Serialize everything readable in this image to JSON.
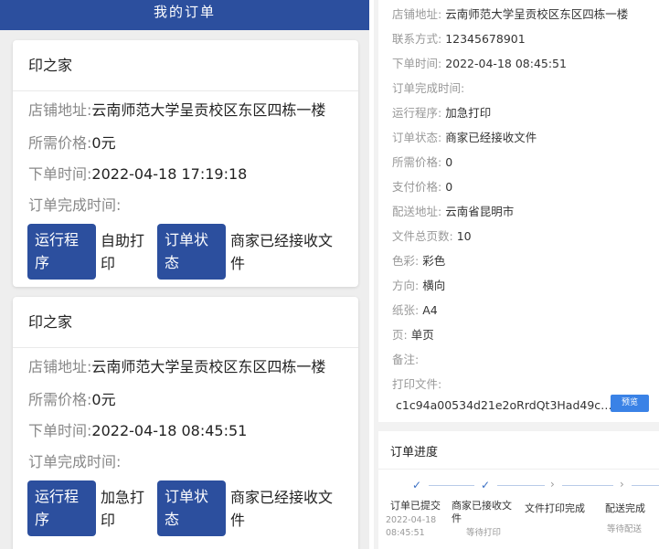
{
  "left": {
    "header_title": "我的订单",
    "orders": [
      {
        "shop_name": "印之家",
        "address_label": "店铺地址:",
        "address": "云南师范大学呈贡校区东区四栋一楼",
        "price_label": "所需价格:",
        "price": "0元",
        "order_time_label": "下单时间:",
        "order_time": "2022-04-18 17:19:18",
        "complete_time_label": "订单完成时间:",
        "program_chip_line1": "运行程",
        "program_chip_line2": "序",
        "program_value_line1": "自助打",
        "program_value_line2": "印",
        "status_chip_line1": "订单状",
        "status_chip_line2": "态",
        "status_value_line1": "商家已经接收文",
        "status_value_line2": "件"
      },
      {
        "shop_name": "印之家",
        "address_label": "店铺地址:",
        "address": "云南师范大学呈贡校区东区四栋一楼",
        "price_label": "所需价格:",
        "price": "0元",
        "order_time_label": "下单时间:",
        "order_time": "2022-04-18 08:45:51",
        "complete_time_label": "订单完成时间:",
        "program_chip_line1": "运行程",
        "program_chip_line2": "序",
        "program_value_line1": "加急打",
        "program_value_line2": "印",
        "status_chip_line1": "订单状",
        "status_chip_line2": "态",
        "status_value_line1": "商家已经接收文",
        "status_value_line2": "件"
      }
    ]
  },
  "right": {
    "details": [
      {
        "label": "店铺地址:",
        "value": "云南师范大学呈贡校区东区四栋一楼"
      },
      {
        "label": "联系方式:",
        "value": "12345678901"
      },
      {
        "label": "下单时间:",
        "value": "2022-04-18 08:45:51"
      },
      {
        "label": "订单完成时间:",
        "value": ""
      },
      {
        "label": "运行程序:",
        "value": "加急打印"
      },
      {
        "label": "订单状态:",
        "value": "商家已经接收文件"
      },
      {
        "label": "所需价格:",
        "value": "0"
      },
      {
        "label": "支付价格:",
        "value": "0"
      },
      {
        "label": "配送地址:",
        "value": "云南省昆明市"
      },
      {
        "label": "文件总页数:",
        "value": "10"
      },
      {
        "label": "色彩:",
        "value": "彩色"
      },
      {
        "label": "方向:",
        "value": "横向"
      },
      {
        "label": "纸张:",
        "value": "A4"
      },
      {
        "label": "页:",
        "value": "单页"
      },
      {
        "label": "备注:",
        "value": ""
      },
      {
        "label": "打印文件:",
        "value": ""
      }
    ],
    "file_name": "c1c94a00534d21e2oRrdQt3Had49c…",
    "preview_label": "预览",
    "progress": {
      "title": "订单进度",
      "steps": [
        {
          "icon": "check-icon",
          "label": "订单已提交",
          "sub1": "2022-04-18",
          "sub2": "08:45:51"
        },
        {
          "icon": "check-icon",
          "label": "商家已接收文",
          "label2": "件",
          "sub1": "等待打印"
        },
        {
          "icon": "chevron-right-icon",
          "label": "文件打印完成"
        },
        {
          "icon": "chevron-right-icon",
          "label": "配送完成",
          "sub1": "等待配送"
        }
      ]
    }
  },
  "colors": {
    "primary": "#2c4f9e",
    "preview_button": "#3a82e6",
    "check": "#3a6fc4"
  }
}
